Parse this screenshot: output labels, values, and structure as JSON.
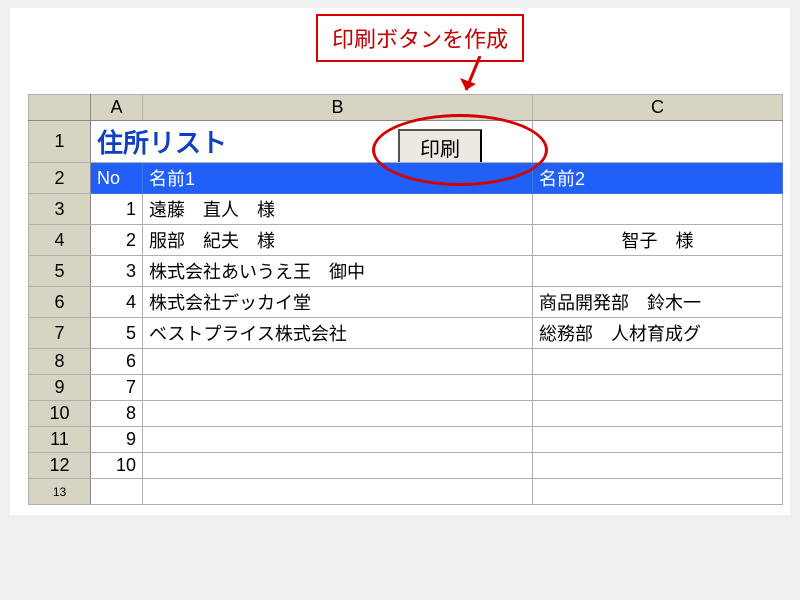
{
  "annotation": {
    "text": "印刷ボタンを作成"
  },
  "columns": {
    "A": "A",
    "B": "B",
    "C": "C"
  },
  "row_labels": [
    "1",
    "2",
    "3",
    "4",
    "5",
    "6",
    "7",
    "8",
    "9",
    "10",
    "11",
    "12",
    "13"
  ],
  "title": "住所リスト",
  "print_button": "印刷",
  "headers": {
    "no": "No",
    "name1": "名前1",
    "name2": "名前2"
  },
  "rows": [
    {
      "no": "1",
      "name1": "遠藤　直人　様",
      "name2": ""
    },
    {
      "no": "2",
      "name1": "服部　紀夫　様",
      "name2": "智子　様"
    },
    {
      "no": "3",
      "name1": "株式会社あいうえ王　御中",
      "name2": ""
    },
    {
      "no": "4",
      "name1": "株式会社デッカイ堂",
      "name2": "商品開発部　鈴木一"
    },
    {
      "no": "5",
      "name1": "ベストプライス株式会社",
      "name2": "総務部　人材育成グ"
    },
    {
      "no": "6",
      "name1": "",
      "name2": ""
    },
    {
      "no": "7",
      "name1": "",
      "name2": ""
    },
    {
      "no": "8",
      "name1": "",
      "name2": ""
    },
    {
      "no": "9",
      "name1": "",
      "name2": ""
    },
    {
      "no": "10",
      "name1": "",
      "name2": ""
    }
  ]
}
